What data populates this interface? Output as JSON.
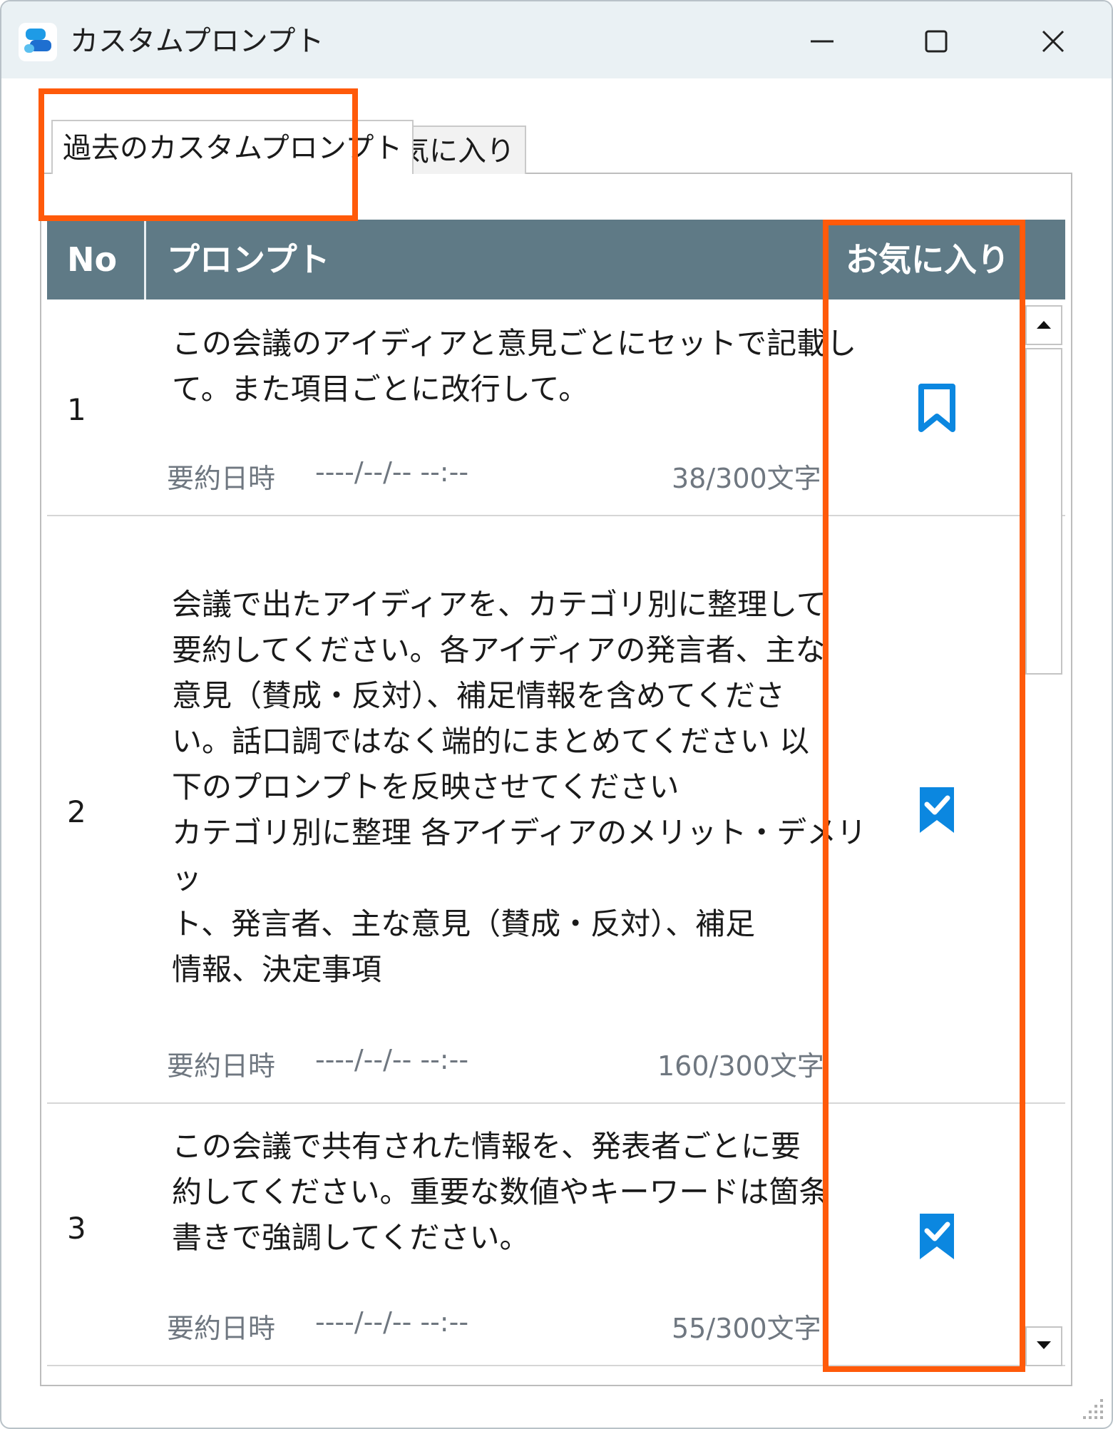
{
  "window": {
    "title": "カスタムプロンプト"
  },
  "tabs": [
    {
      "label": "過去のカスタムプロンプト",
      "active": true
    },
    {
      "label": "お気に入り",
      "active": false
    }
  ],
  "grid": {
    "columns": {
      "no": "No",
      "prompt": "プロンプト",
      "favorite": "お気に入り"
    },
    "rows": [
      {
        "no": "1",
        "text": "この会議のアイディアと意見ごとにセットで記載し\nて。また項目ごとに改行して。",
        "meta_label": "要約日時",
        "meta_date": "----/--/-- --:--",
        "char_count": "38/300文字",
        "favorite": false
      },
      {
        "no": "2",
        "text": "会議で出たアイディアを、カテゴリ別に整理して\n要約してください。各アイディアの発言者、主な\n意見（賛成・反対）、補足情報を含めてくださ\nい。話口調ではなく端的にまとめてください 以\n下のプロンプトを反映させてください\nカテゴリ別に整理 各アイディアのメリット・デメリッ\nト、発言者、主な意見（賛成・反対）、補足\n情報、決定事項",
        "meta_label": "要約日時",
        "meta_date": "----/--/-- --:--",
        "char_count": "160/300文字",
        "favorite": true
      },
      {
        "no": "3",
        "text": "この会議で共有された情報を、発表者ごとに要\n約してください。重要な数値やキーワードは箇条\n書きで強調してください。",
        "meta_label": "要約日時",
        "meta_date": "----/--/-- --:--",
        "char_count": "55/300文字",
        "favorite": true
      }
    ]
  },
  "colors": {
    "header_bg": "#5f7a86",
    "highlight": "#ff5a0a",
    "accent": "#0b87e0",
    "titlebar_bg": "#eaf1f4"
  },
  "icons": {
    "app": "chat-bubbles-icon",
    "minimize": "minimize-icon",
    "maximize": "maximize-icon",
    "close": "close-icon",
    "favorite_off": "bookmark-outline-icon",
    "favorite_on": "bookmark-check-icon",
    "scroll_up": "arrow-up-icon",
    "scroll_down": "arrow-down-icon",
    "resize_grip": "resize-grip-icon"
  }
}
